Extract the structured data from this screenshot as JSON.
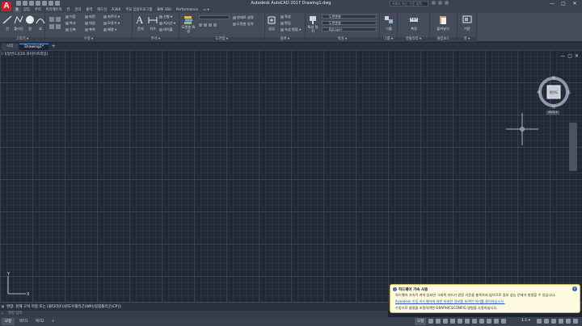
{
  "window": {
    "title": "Autodesk AutoCAD 2017    Drawing1.dwg",
    "search_placeholder": "키워드 또는 구문 입력",
    "controls": [
      "—",
      "▢",
      "✕"
    ]
  },
  "ribbon_tabs": [
    "홈",
    "삽입",
    "주석",
    "파라메트릭",
    "뷰",
    "관리",
    "출력",
    "애드인",
    "A360",
    "주요 응용프로그램",
    "BIM 360",
    "Performance",
    "▭ ▾"
  ],
  "ribbon_active_tab": "홈",
  "ribbon": {
    "groups": [
      {
        "label": "그리기 ▾"
      },
      {
        "label": "수정 ▾"
      },
      {
        "label": "주석 ▾"
      },
      {
        "label": "도면층 ▾"
      },
      {
        "label": "블록 ▾"
      },
      {
        "label": "특성 ▾"
      },
      {
        "label": "그룹 ▾"
      },
      {
        "label": "유틸리티 ▾"
      },
      {
        "label": "클립보드"
      },
      {
        "label": "뷰 ▾"
      }
    ],
    "draw": {
      "line": "선",
      "polyline": "폴리선",
      "circle": "원",
      "arc": "호"
    },
    "modify": {
      "move": "이동",
      "rotate": "회전",
      "trim": "자르기 ▾",
      "copy": "복사",
      "mirror": "대칭",
      "fillet": "모깎기 ▾",
      "stretch": "신축",
      "scale": "축척",
      "array": "배열 ▾"
    },
    "annotation": {
      "text": "문자",
      "dimension": "치수",
      "linear": "선형 ▾",
      "leader": "지시선 ▾",
      "table": "테이블"
    },
    "layers": {
      "layer_props": "도면층 특성",
      "make_current": "현재로 설정",
      "match_layer": "도면층 일치"
    },
    "block": {
      "insert": "삽입",
      "create": "작성",
      "edit": "편집",
      "edit_attr": "속성 편집 ▾"
    },
    "properties": {
      "match": "특성 일치",
      "by_layer": "도면층별",
      "line_layer": "도면층별",
      "bylayer": "ByLayer"
    },
    "group": {
      "label": "그룹"
    },
    "utilities": {
      "measure": "측정"
    },
    "clipboard": {
      "paste": "붙여넣기"
    },
    "view": {
      "base": "기준"
    }
  },
  "doc_tabs": [
    "시작",
    "Drawing1*"
  ],
  "doc_active_tab": "Drawing1*",
  "viewport": {
    "view_controls": "[-][평면도][2D 와이어프레임]",
    "window_controls": [
      "—",
      "▢",
      "✕"
    ]
  },
  "viewcube": {
    "north": "북",
    "south": "남",
    "east": "동",
    "west": "서",
    "face": "평면도",
    "wcs": "WCS ▾"
  },
  "ucs": {
    "x": "X",
    "y": "Y"
  },
  "command": {
    "history": "명령: 현재 구석 지정 또는 [울타리(F)/윈도우폴리곤(WP)/걸침폴리곤(CP)]:",
    "input_placeholder": "명령 입력"
  },
  "layout_tabs": [
    "모형",
    "배치1",
    "배치2"
  ],
  "layout_active_tab": "모형",
  "status": {
    "model": "모형",
    "scale": "1:1 ▾"
  },
  "notification": {
    "title": "하드웨어 가속 사용",
    "line1": "하드웨어 가속이 켜져 있지만 그래픽 카드가 권장 기준을 충족하지 않으므로 일부 성능 문제가 발생할 수 있습니다.",
    "link": "Autodesk 인증 하드웨어에 대한 자세한 정보를 보려면 여기를 클릭하십시오.",
    "line3": "수동으로 설정을 조정하려면 GRAPHICSCONFIG 명령을 사용하십시오."
  },
  "colors": {
    "canvas": "#212836",
    "ribbon": "#444c5a",
    "accent_red": "#c8202b",
    "balloon": "#fffbe0"
  }
}
